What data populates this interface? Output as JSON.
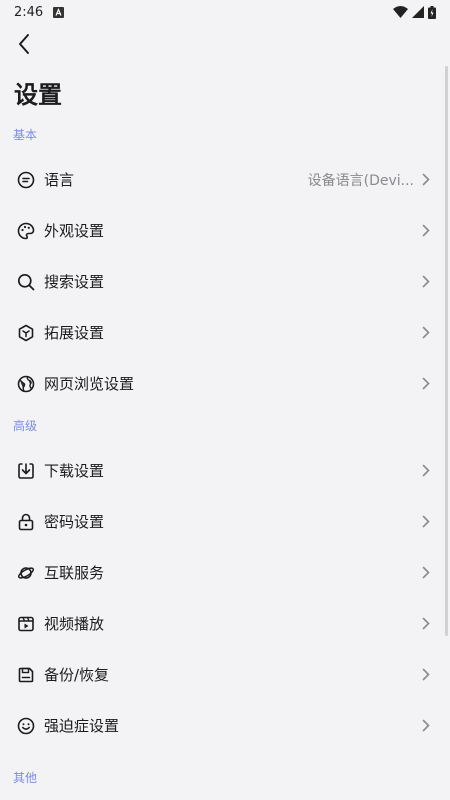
{
  "status_bar": {
    "time": "2:46"
  },
  "page": {
    "title": "设置"
  },
  "sections": {
    "basic": {
      "label": "基本"
    },
    "advanced": {
      "label": "高级"
    },
    "other": {
      "label": "其他"
    }
  },
  "items": {
    "language": {
      "label": "语言",
      "value": "设备语言(Devi...",
      "icon": "chat-lines-icon"
    },
    "appearance": {
      "label": "外观设置",
      "icon": "palette-icon"
    },
    "search": {
      "label": "搜索设置",
      "icon": "search-icon"
    },
    "extensions": {
      "label": "拓展设置",
      "icon": "cube-icon"
    },
    "browsing": {
      "label": "网页浏览设置",
      "icon": "globe-icon"
    },
    "download": {
      "label": "下载设置",
      "icon": "download-icon"
    },
    "password": {
      "label": "密码设置",
      "icon": "lock-icon"
    },
    "services": {
      "label": "互联服务",
      "icon": "planet-icon"
    },
    "video": {
      "label": "视频播放",
      "icon": "video-icon"
    },
    "backup": {
      "label": "备份/恢复",
      "icon": "save-icon"
    },
    "ocd": {
      "label": "强迫症设置",
      "icon": "smile-icon"
    }
  },
  "colors": {
    "accent": "#7b8ce6",
    "background": "#f3f3f5",
    "secondary_text": "#8a8a8e"
  }
}
